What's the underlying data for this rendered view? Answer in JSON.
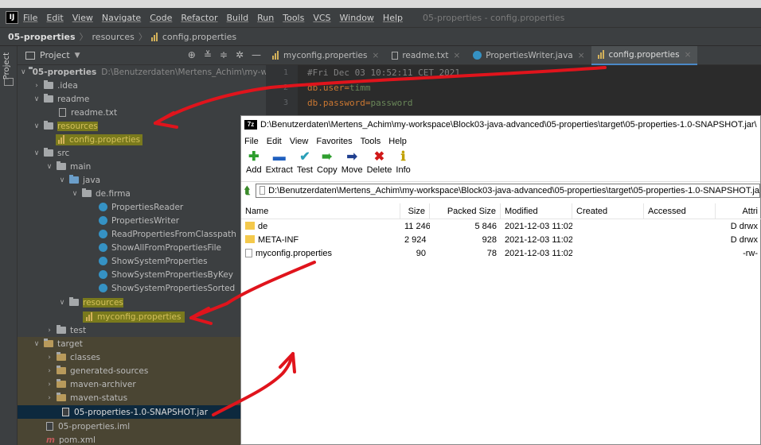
{
  "window": {
    "title": "05-properties - config.properties",
    "menu": [
      "File",
      "Edit",
      "View",
      "Navigate",
      "Code",
      "Refactor",
      "Build",
      "Run",
      "Tools",
      "VCS",
      "Window",
      "Help"
    ]
  },
  "breadcrumb": {
    "project": "05-properties",
    "folder": "resources",
    "file": "config.properties"
  },
  "toolstrip": {
    "label": "Project"
  },
  "project_panel": {
    "title": "Project",
    "tree": [
      {
        "label": "05-properties",
        "path": "D:\\Benutzerdaten\\Mertens_Achim\\my-wo",
        "icon": "module-folder-icon"
      },
      {
        "label": ".idea",
        "icon": "folder-icon"
      },
      {
        "label": "readme",
        "icon": "folder-icon"
      },
      {
        "label": "readme.txt",
        "icon": "text-file-icon"
      },
      {
        "label": "resources",
        "icon": "folder-icon"
      },
      {
        "label": "config.properties",
        "icon": "properties-file-icon"
      },
      {
        "label": "src",
        "icon": "folder-icon"
      },
      {
        "label": "main",
        "icon": "folder-icon"
      },
      {
        "label": "java",
        "icon": "source-folder-icon"
      },
      {
        "label": "de.firma",
        "icon": "package-icon"
      },
      {
        "label": "PropertiesReader",
        "icon": "class-icon"
      },
      {
        "label": "PropertiesWriter",
        "icon": "class-icon"
      },
      {
        "label": "ReadPropertiesFromClasspath",
        "icon": "class-icon"
      },
      {
        "label": "ShowAllFromPropertiesFile",
        "icon": "class-icon"
      },
      {
        "label": "ShowSystemProperties",
        "icon": "class-icon"
      },
      {
        "label": "ShowSystemPropertiesByKey",
        "icon": "class-icon"
      },
      {
        "label": "ShowSystemPropertiesSorted",
        "icon": "class-icon"
      },
      {
        "label": "resources",
        "icon": "resources-folder-icon"
      },
      {
        "label": "myconfig.properties",
        "icon": "properties-file-icon"
      },
      {
        "label": "test",
        "icon": "folder-icon"
      },
      {
        "label": "target",
        "icon": "folder-icon"
      },
      {
        "label": "classes",
        "icon": "folder-icon"
      },
      {
        "label": "generated-sources",
        "icon": "folder-icon"
      },
      {
        "label": "maven-archiver",
        "icon": "folder-icon"
      },
      {
        "label": "maven-status",
        "icon": "folder-icon"
      },
      {
        "label": "05-properties-1.0-SNAPSHOT.jar",
        "icon": "jar-file-icon"
      },
      {
        "label": "05-properties.iml",
        "icon": "iml-file-icon"
      },
      {
        "label": "pom.xml",
        "icon": "maven-icon"
      }
    ]
  },
  "editor": {
    "tabs": [
      {
        "label": "myconfig.properties",
        "active": false
      },
      {
        "label": "readme.txt",
        "active": false
      },
      {
        "label": "PropertiesWriter.java",
        "active": false
      },
      {
        "label": "config.properties",
        "active": true
      }
    ],
    "lines": [
      {
        "num": "1",
        "text": "#Fri Dec 03 10:52:11 CET 2021"
      },
      {
        "num": "2",
        "key": "db.user",
        "value": "timm"
      },
      {
        "num": "3",
        "key": "db.password",
        "value": "password"
      }
    ]
  },
  "zip": {
    "title": "D:\\Benutzerdaten\\Mertens_Achim\\my-workspace\\Block03-java-advanced\\05-properties\\target\\05-properties-1.0-SNAPSHOT.jar\\",
    "menu": [
      "File",
      "Edit",
      "View",
      "Favorites",
      "Tools",
      "Help"
    ],
    "toolbar": [
      {
        "label": "Add",
        "icon": "add-icon",
        "color": "#2e9e2e",
        "glyph": "✚"
      },
      {
        "label": "Extract",
        "icon": "extract-icon",
        "color": "#1f5fbf",
        "glyph": "▬"
      },
      {
        "label": "Test",
        "icon": "test-icon",
        "color": "#2a9fb8",
        "glyph": "✔"
      },
      {
        "label": "Copy",
        "icon": "copy-icon",
        "color": "#2e9e2e",
        "glyph": "➠"
      },
      {
        "label": "Move",
        "icon": "move-icon",
        "color": "#1f3f8f",
        "glyph": "➡"
      },
      {
        "label": "Delete",
        "icon": "delete-icon",
        "color": "#d01818",
        "glyph": "✖"
      },
      {
        "label": "Info",
        "icon": "info-icon",
        "color": "#c0a000",
        "glyph": "ℹ"
      }
    ],
    "address": "D:\\Benutzerdaten\\Mertens_Achim\\my-workspace\\Block03-java-advanced\\05-properties\\target\\05-properties-1.0-SNAPSHOT.ja",
    "columns": [
      "Name",
      "Size",
      "Packed Size",
      "Modified",
      "Created",
      "Accessed",
      "Attri"
    ],
    "rows": [
      {
        "name": "de",
        "size": "11 246",
        "packed": "5 846",
        "modified": "2021-12-03 11:02",
        "attr": "D drwx",
        "type": "folder"
      },
      {
        "name": "META-INF",
        "size": "2 924",
        "packed": "928",
        "modified": "2021-12-03 11:02",
        "attr": "D drwx",
        "type": "folder"
      },
      {
        "name": "myconfig.properties",
        "size": "90",
        "packed": "78",
        "modified": "2021-12-03 11:02",
        "attr": "-rw-",
        "type": "file"
      }
    ]
  },
  "colors": {
    "annotation_red": "#e0141c",
    "highlight_yellow": "#8a8a1a",
    "selection": "#0d293e"
  }
}
